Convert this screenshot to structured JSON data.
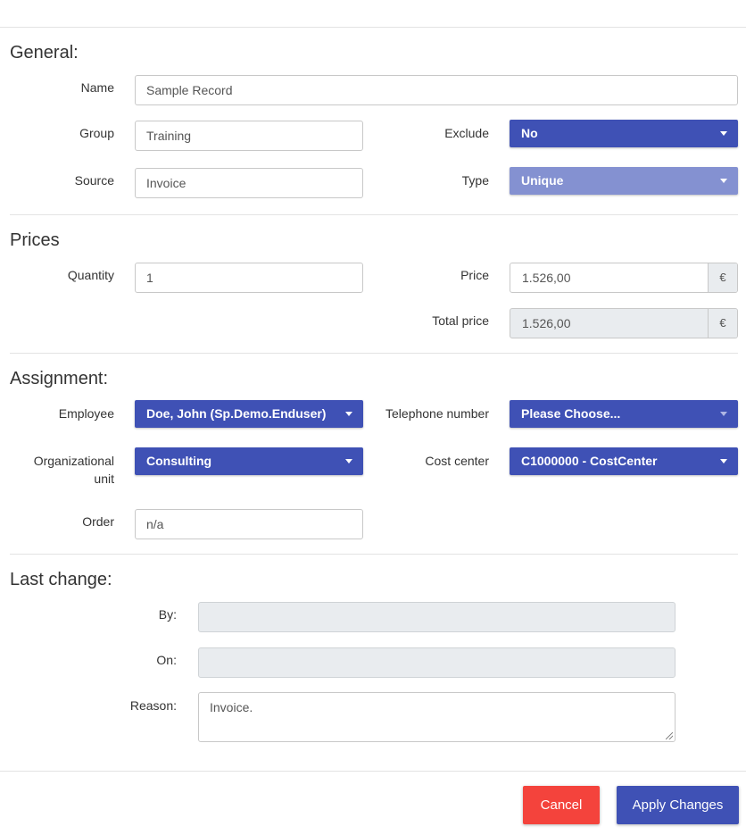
{
  "general": {
    "title": "General:",
    "name_label": "Name",
    "name_value": "Sample Record",
    "group_label": "Group",
    "group_value": "Training",
    "exclude_label": "Exclude",
    "exclude_value": "No",
    "source_label": "Source",
    "source_value": "Invoice",
    "type_label": "Type",
    "type_value": "Unique"
  },
  "prices": {
    "title": "Prices",
    "quantity_label": "Quantity",
    "quantity_value": "1",
    "price_label": "Price",
    "price_value": "1.526,00",
    "currency": "€",
    "total_label": "Total price",
    "total_value": "1.526,00"
  },
  "assignment": {
    "title": "Assignment:",
    "employee_label": "Employee",
    "employee_value": "Doe, John (Sp.Demo.Enduser)",
    "telephone_label": "Telephone number",
    "telephone_value": "Please Choose...",
    "org_unit_label_line1": "Organizational",
    "org_unit_label_line2": "unit",
    "org_unit_value": "Consulting",
    "cost_center_label": "Cost center",
    "cost_center_value": "C1000000 - CostCenter",
    "order_label": "Order",
    "order_value": "n/a"
  },
  "last_change": {
    "title": "Last change:",
    "by_label": "By:",
    "by_value": "",
    "on_label": "On:",
    "on_value": "",
    "reason_label": "Reason:",
    "reason_value": "Invoice."
  },
  "footer": {
    "cancel_label": "Cancel",
    "apply_label": "Apply Changes"
  },
  "colors": {
    "primary": "#3f51b5",
    "primary_disabled": "#8491d1",
    "danger": "#f4433c",
    "disabled_bg": "#e9ecef"
  }
}
